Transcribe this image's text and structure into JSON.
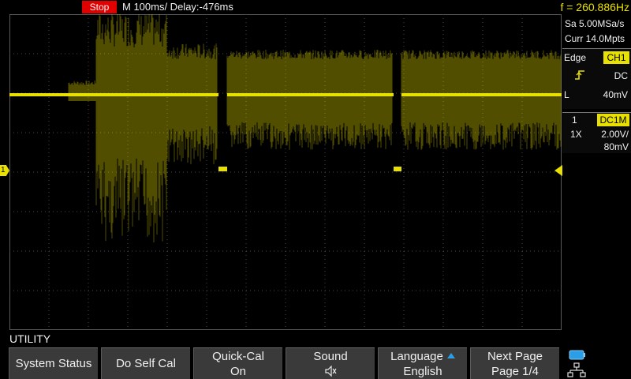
{
  "topbar": {
    "run_state": "Stop",
    "timebase": "M 100ms/  Delay:-476ms",
    "frequency": "f = 260.886Hz"
  },
  "sidepanel": {
    "sample_rate": "Sa 5.00MSa/s",
    "memory_depth": "Curr 14.0Mpts",
    "trigger": {
      "mode_label": "Edge",
      "source": "CH1",
      "slope_icon": "rising-edge-icon",
      "coupling": "DC",
      "level_label": "L",
      "level_value": "40mV"
    },
    "channel": {
      "number": "1",
      "coupling_impedance": "DC1M",
      "probe": "1X",
      "scale": "2.00V/",
      "offset": "80mV"
    }
  },
  "markers": {
    "channel_marker": "1"
  },
  "menu": {
    "title": "UTILITY",
    "softkeys": [
      {
        "line1": "System Status",
        "line2": ""
      },
      {
        "line1": "Do Self Cal",
        "line2": ""
      },
      {
        "line1": "Quick-Cal",
        "line2": "On"
      },
      {
        "line1": "Sound",
        "line2": "🔈"
      },
      {
        "line1": "Language",
        "line2": "English"
      },
      {
        "line1": "Next Page",
        "line2": "Page 1/4"
      }
    ]
  },
  "colors": {
    "trace": "#e8e000",
    "stop": "#e00000",
    "accent": "#2a9fe8",
    "grid": "#4a4a4a"
  }
}
